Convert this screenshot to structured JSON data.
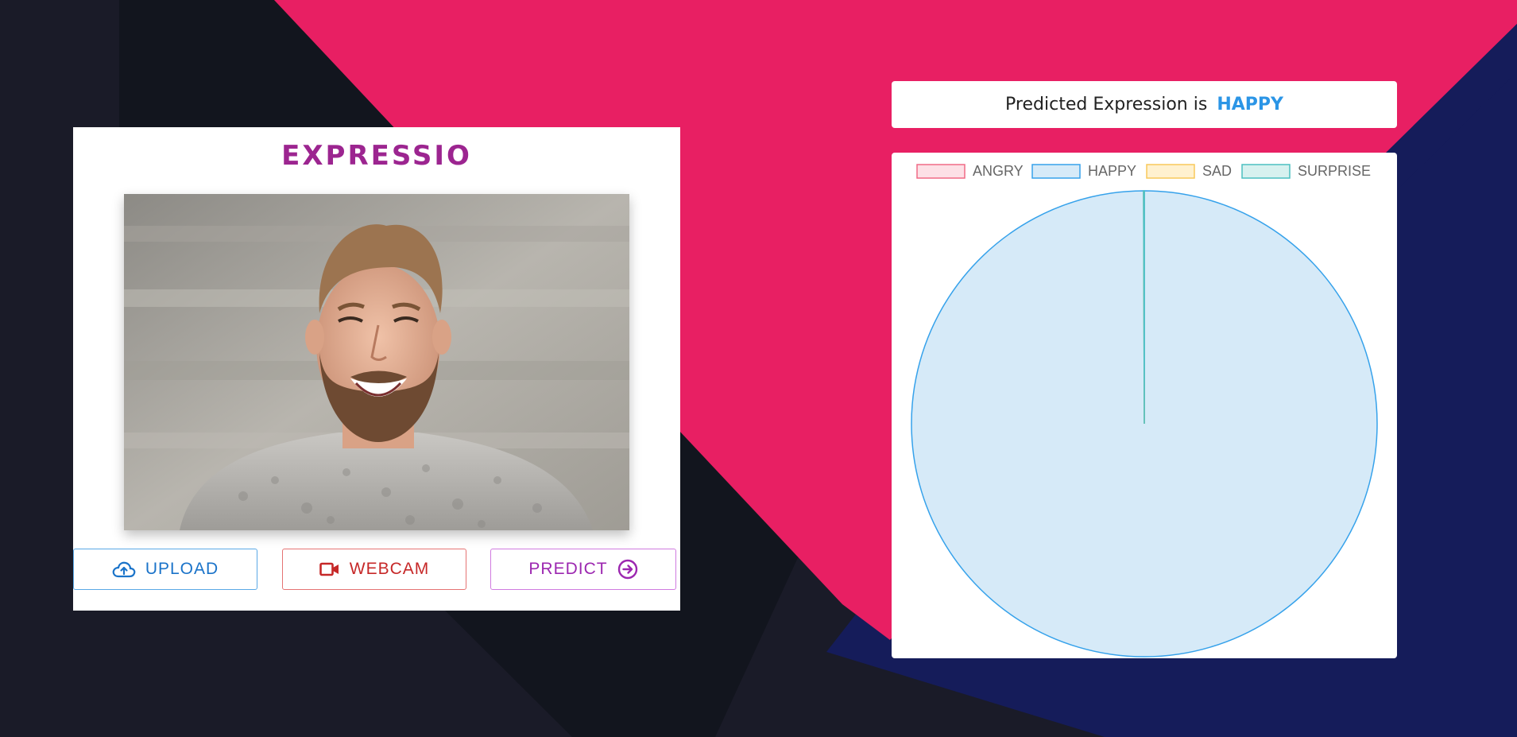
{
  "app": {
    "title": "EXPRESSIO"
  },
  "image": {
    "subject": "smiling bearded man in grey t-shirt"
  },
  "buttons": {
    "upload": {
      "label": "UPLOAD",
      "icon": "cloud-upload-icon"
    },
    "webcam": {
      "label": "WEBCAM",
      "icon": "video-camera-icon"
    },
    "predict": {
      "label": "PREDICT",
      "icon": "arrow-circle-right-icon"
    }
  },
  "prediction": {
    "prefix": "Predicted Expression is",
    "value": "HAPPY"
  },
  "colors": {
    "brand": "#9c2590",
    "accent_pink": "#e81f63",
    "accent_navy": "#151c5a",
    "background_dark": "#1a1b28",
    "prediction_value": "#2b95e6"
  },
  "chart_data": {
    "type": "pie",
    "categories": [
      "ANGRY",
      "HAPPY",
      "SAD",
      "SURPRISE"
    ],
    "values": [
      0,
      99.95,
      0,
      0.05
    ],
    "colors": {
      "fill": [
        "#fde0e6",
        "#d6eaf8",
        "#fff1cf",
        "#d7f1ef"
      ],
      "stroke": [
        "#f06a85",
        "#36a2eb",
        "#f8c95a",
        "#4bc0c0"
      ]
    },
    "legend_position": "top"
  }
}
